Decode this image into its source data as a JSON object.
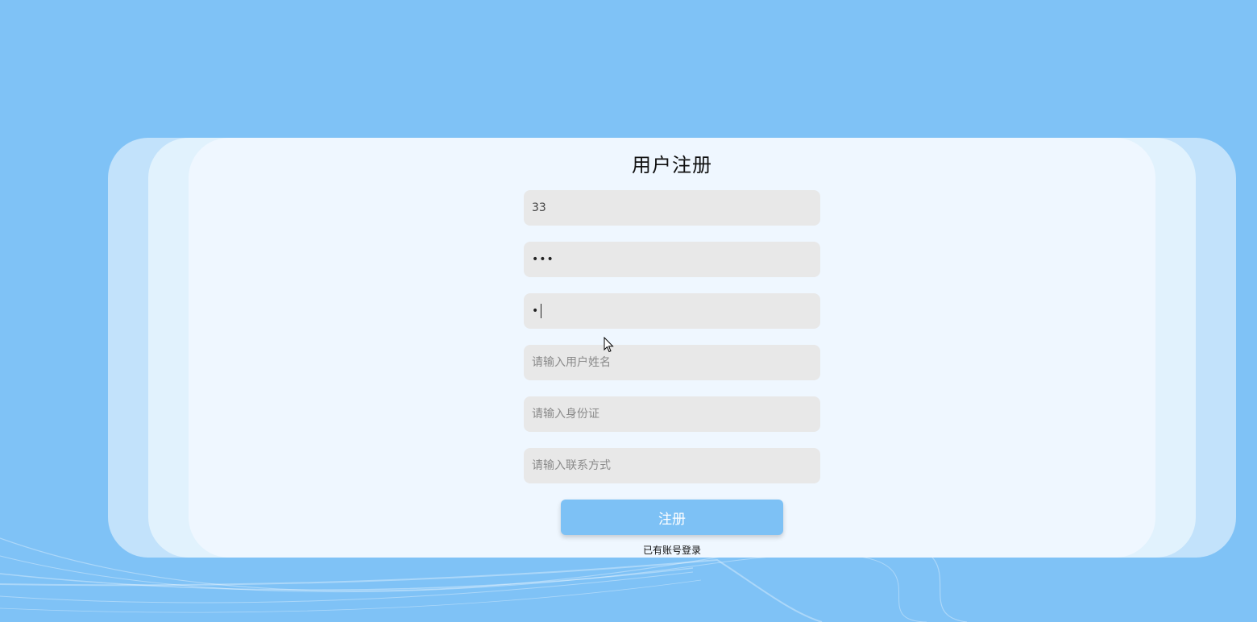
{
  "page": {
    "title": "用户注册"
  },
  "form": {
    "username": {
      "value": "33"
    },
    "password": {
      "value": "•••"
    },
    "confirm_password": {
      "value": "•"
    },
    "real_name": {
      "placeholder": "请输入用户姓名"
    },
    "id_card": {
      "placeholder": "请输入身份证"
    },
    "contact": {
      "placeholder": "请输入联系方式"
    },
    "submit_label": "注册",
    "login_link": "已有账号登录"
  },
  "colors": {
    "background": "#7fc2f6",
    "card": "#eff7ff",
    "field": "#e8e8e8",
    "button": "#7dc1f5"
  },
  "icons": {
    "cursor": "mouse-pointer-icon"
  }
}
